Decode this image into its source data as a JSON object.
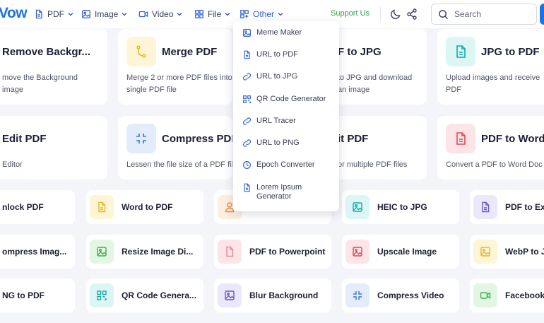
{
  "header": {
    "logo": "Vow",
    "nav": [
      {
        "label": "PDF",
        "icon": "file-icon"
      },
      {
        "label": "Image",
        "icon": "image-icon"
      },
      {
        "label": "Video",
        "icon": "video-icon"
      },
      {
        "label": "File",
        "icon": "grid-icon"
      },
      {
        "label": "Other",
        "icon": "apps-icon"
      }
    ],
    "support": "Support Us",
    "search_placeholder": "Search"
  },
  "dropdown": [
    {
      "label": "Meme Maker",
      "icon": "image-icon"
    },
    {
      "label": "URL to PDF",
      "icon": "file-icon"
    },
    {
      "label": "URL to JPG",
      "icon": "link-icon"
    },
    {
      "label": "QR Code Generator",
      "icon": "qr-icon"
    },
    {
      "label": "URL Tracer",
      "icon": "link-icon"
    },
    {
      "label": "URL to PNG",
      "icon": "link-icon"
    },
    {
      "label": "Epoch Converter",
      "icon": "clock-icon"
    },
    {
      "label": "Lorem Ipsum Generator",
      "icon": "file-icon"
    }
  ],
  "cards": [
    {
      "title": "Remove Backgr...",
      "desc_line1": "move the Background",
      "desc_line2": "image"
    },
    {
      "title": "Merge PDF",
      "desc_line1": "Merge 2 or more PDF files into",
      "desc_line2": "single PDF file"
    },
    {
      "title": "F to JPG",
      "desc_line1": "to JPG and download",
      "desc_line2": "an image"
    },
    {
      "title": "JPG to PDF",
      "desc_line1": "Upload images and receive",
      "desc_line2": "PDF"
    },
    {
      "title": "Edit PDF",
      "desc_line1": "Editor",
      "desc_line2": ""
    },
    {
      "title": "Compress PDF",
      "desc_line1": "Lessen the file size of a PDF file",
      "desc_line2": ""
    },
    {
      "title": "it PDF",
      "desc_line1": "or multiple PDF files",
      "desc_line2": ""
    },
    {
      "title": "PDF to Word",
      "desc_line1": "Convert a PDF to Word Doc",
      "desc_line2": ""
    }
  ],
  "small_cards": [
    {
      "title": "nlock PDF"
    },
    {
      "title": "Word to PDF"
    },
    {
      "title": ""
    },
    {
      "title": "HEIC to JPG"
    },
    {
      "title": "PDF to Exc"
    },
    {
      "title": "ompress Imag..."
    },
    {
      "title": "Resize Image Di..."
    },
    {
      "title": "PDF to Powerpoint"
    },
    {
      "title": "Upscale Image"
    },
    {
      "title": "WebP to J"
    },
    {
      "title": "NG to PDF"
    },
    {
      "title": "QR Code Genera..."
    },
    {
      "title": "Blur Background"
    },
    {
      "title": "Compress Video"
    },
    {
      "title": "Facebook"
    }
  ],
  "colors": {
    "brand": "#1a73e8",
    "support": "#2e9e4a",
    "yellow_bg": "#fdf5d6",
    "yellow": "#e8b923",
    "teal_bg": "#dbf6f5",
    "teal": "#15a9a4",
    "blue_bg": "#e2ecfb",
    "blue": "#3a72d8",
    "red_bg": "#fde4e6",
    "red": "#e54757",
    "green_bg": "#e3f6e3",
    "green": "#3db34a",
    "purple_bg": "#ebe8fb",
    "purple": "#6a55d4",
    "orange": "#f08a3a"
  }
}
